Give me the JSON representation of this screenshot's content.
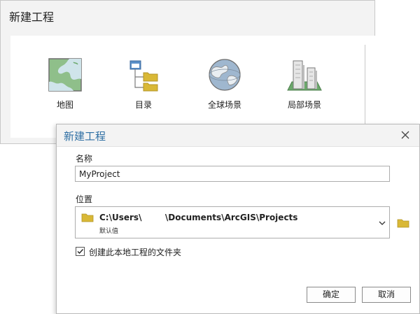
{
  "background_panel": {
    "title": "新建工程",
    "tiles": [
      {
        "label": "地图",
        "icon": "map-icon"
      },
      {
        "label": "目录",
        "icon": "catalog-icon"
      },
      {
        "label": "全球场景",
        "icon": "globe-icon"
      },
      {
        "label": "局部场景",
        "icon": "local-scene-icon"
      }
    ]
  },
  "dialog": {
    "title": "新建工程",
    "name_label": "名称",
    "name_value": "MyProject",
    "location_label": "位置",
    "location_path": "C:\\Users\\        \\Documents\\ArcGIS\\Projects",
    "location_sub": "默认值",
    "checkbox_label": "创建此本地工程的文件夹",
    "checkbox_checked": true,
    "ok_label": "确定",
    "cancel_label": "取消"
  },
  "colors": {
    "title_blue": "#2d6ea3",
    "folder_yellow": "#d9b836",
    "panel_bg": "#f3f3f3"
  }
}
